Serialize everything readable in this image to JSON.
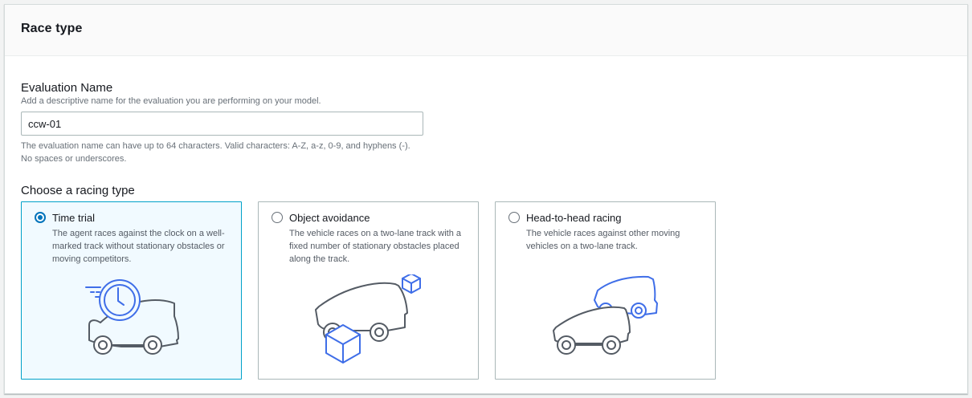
{
  "panel": {
    "title": "Race type"
  },
  "evaluation": {
    "label": "Evaluation Name",
    "description": "Add a descriptive name for the evaluation you are performing on your model.",
    "value": "ccw-01",
    "constraint": "The evaluation name can have up to 64 characters. Valid characters: A-Z, a-z, 0-9, and hyphens (-). No spaces or underscores."
  },
  "racing": {
    "label": "Choose a racing type",
    "options": [
      {
        "title": "Time trial",
        "description": "The agent races against the clock on a well-marked track without stationary obstacles or moving competitors.",
        "selected": true
      },
      {
        "title": "Object avoidance",
        "description": "The vehicle races on a two-lane track with a fixed number of stationary obstacles placed along the track.",
        "selected": false
      },
      {
        "title": "Head-to-head racing",
        "description": "The vehicle races against other moving vehicles on a two-lane track.",
        "selected": false
      }
    ]
  },
  "colors": {
    "accent": "#0073bb",
    "selected_border": "#00a1c9",
    "selected_bg": "#f1faff",
    "illustration_blue": "#3f6ee8",
    "illustration_gray": "#545b64"
  }
}
